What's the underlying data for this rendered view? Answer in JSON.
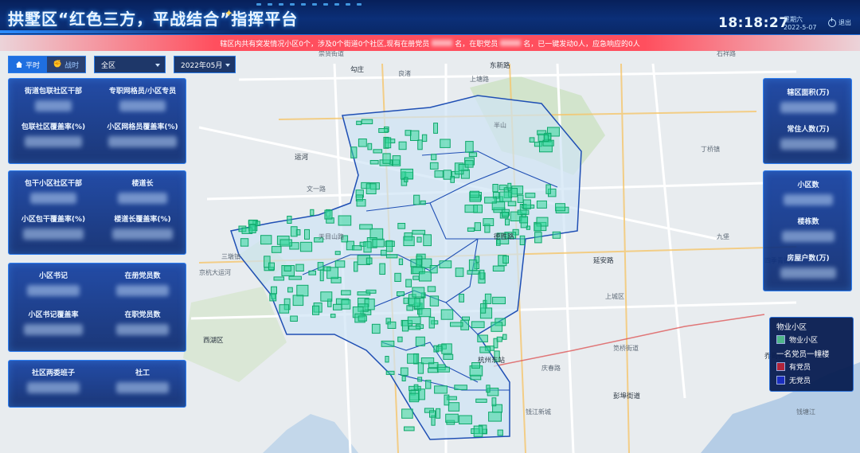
{
  "header": {
    "title": "拱墅区“红色三方，平战结合”指挥平台",
    "time": "18:18:27",
    "weekday": "星期六",
    "date": "2022-5-07",
    "logout_label": "退出"
  },
  "alert": {
    "part1": "辖区内共有突发情况小区0个，涉及0个街道0个社区,现有在册党员",
    "part2": "名，在职党员",
    "part3": "名，已一键发动0人，应急响应的0人"
  },
  "controls": {
    "mode_peace": "平时",
    "mode_war": "战时",
    "region": "全区",
    "month": "2022年05月"
  },
  "left_panels": [
    {
      "items": [
        "街道包联社区干部",
        "专职网格员/小区专员",
        "包联社区覆盖率(%)",
        "小区网格员覆盖率(%)"
      ]
    },
    {
      "items": [
        "包干小区社区干部",
        "楼道长",
        "小区包干覆盖率(%)",
        "楼道长覆盖率(%)"
      ]
    },
    {
      "items": [
        "小区书记",
        "在册党员数",
        "小区书记覆盖率",
        "在职党员数"
      ]
    },
    {
      "items": [
        "社区两委班子",
        "社工"
      ]
    }
  ],
  "right_panels": [
    {
      "items": [
        "辖区面积(万)",
        "常住人数(万)"
      ]
    },
    {
      "items": [
        "小区数",
        "楼栋数",
        "房屋户数(万)"
      ]
    }
  ],
  "legend": {
    "title1": "物业小区",
    "item1": "物业小区",
    "title2": "一名党员一幢楼",
    "item2": "有党员",
    "item3": "无党员",
    "color_property": "#4fb58a",
    "color_has_member": "#b0243a",
    "color_no_member": "#1a2dbf"
  },
  "map_labels": [
    "东新路",
    "上塘路",
    "石祥路",
    "运河",
    "三墩镇",
    "京杭大运河",
    "西湖区",
    "上城区",
    "笕桥街道",
    "彭埠街道",
    "丁桥镇",
    "崇贤街道",
    "勾庄",
    "良渚",
    "半山",
    "德胜路",
    "文一路",
    "天目山路",
    "延安路",
    "庆春路",
    "钱江新城",
    "乔司街道",
    "九堡",
    "四季青街道",
    "杭州东站",
    "钱塘江"
  ]
}
